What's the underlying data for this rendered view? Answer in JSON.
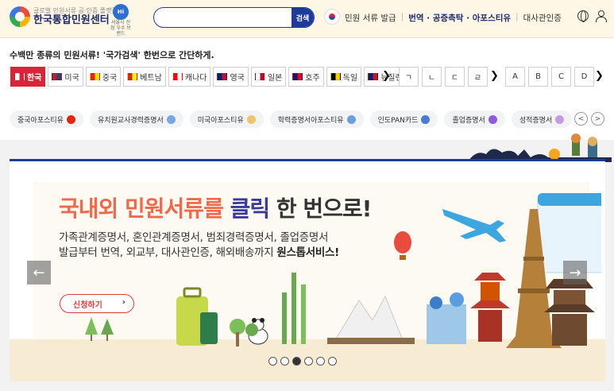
{
  "header": {
    "logo_sub": "글로벌 민원서류 공·인증 플랫폼",
    "logo_main": "한국통합민원센터",
    "badge": "Hi",
    "badge_sub": "서울시 선정 우수 브랜드",
    "search_placeholder": "",
    "search_button": "검색",
    "nav": [
      {
        "label": "민원 서류 발급"
      },
      {
        "label": "번역 · 공증촉탁 · 아포스티유"
      },
      {
        "label": "대사관인증"
      }
    ]
  },
  "tagline": "수백만 종류의 민원서류! '국가검색' 한번으로 간단하게.",
  "countries": [
    {
      "label": "한국",
      "active": true,
      "flag": [
        "#ffffff",
        "#d72638"
      ]
    },
    {
      "label": "미국",
      "flag": [
        "#b22234",
        "#3c3b6e"
      ]
    },
    {
      "label": "중국",
      "flag": [
        "#de2910",
        "#ffde00"
      ]
    },
    {
      "label": "베트남",
      "flag": [
        "#da251d",
        "#ffff00"
      ]
    },
    {
      "label": "캐나다",
      "flag": [
        "#ff0000",
        "#ffffff"
      ]
    },
    {
      "label": "영국",
      "flag": [
        "#012169",
        "#c8102e"
      ]
    },
    {
      "label": "일본",
      "flag": [
        "#ffffff",
        "#bc002d"
      ]
    },
    {
      "label": "호주",
      "flag": [
        "#012169",
        "#e4002b"
      ]
    },
    {
      "label": "독일",
      "flag": [
        "#000000",
        "#ffce00"
      ]
    },
    {
      "label": "뉴질랜드",
      "flag": [
        "#012169",
        "#cc142b"
      ]
    }
  ],
  "country_next": "❯",
  "letters": [
    "ㄱ",
    "ㄴ",
    "ㄷ",
    "ㄹ",
    "A",
    "B",
    "C",
    "D"
  ],
  "letters_prev": "❯",
  "letters_next": "❯",
  "chips": [
    {
      "label": "중국아포스티유",
      "color": "#de2910"
    },
    {
      "label": "유치원교사경력증명서",
      "color": "#7aa7e0"
    },
    {
      "label": "미국아포스티유",
      "color": "#f0c36d"
    },
    {
      "label": "학력증명서아포스티유",
      "color": "#6ca0dc"
    },
    {
      "label": "인도PAN카드",
      "color": "#4a7bd0"
    },
    {
      "label": "졸업증명서",
      "color": "#8e5bd8"
    },
    {
      "label": "성적증명서",
      "color": "#c79be0"
    }
  ],
  "chip_prev": "<",
  "chip_next": ">",
  "banner": {
    "headline_a": "국내외 민원서류를 ",
    "headline_b": "클릭",
    "headline_c": " 한 번으로!",
    "desc1": "가족관계증명서, 혼인관계증명서, 범죄경력증명서, 졸업증명서",
    "desc2_a": "발급부터 번역, 외교부, 대사관인증, 해외배송까지 ",
    "desc2_b": "원스톱서비스!",
    "cta": "신청하기",
    "cta_arrow": "›",
    "prev": "←",
    "next": "→",
    "slides": 6,
    "active_slide": 3
  }
}
